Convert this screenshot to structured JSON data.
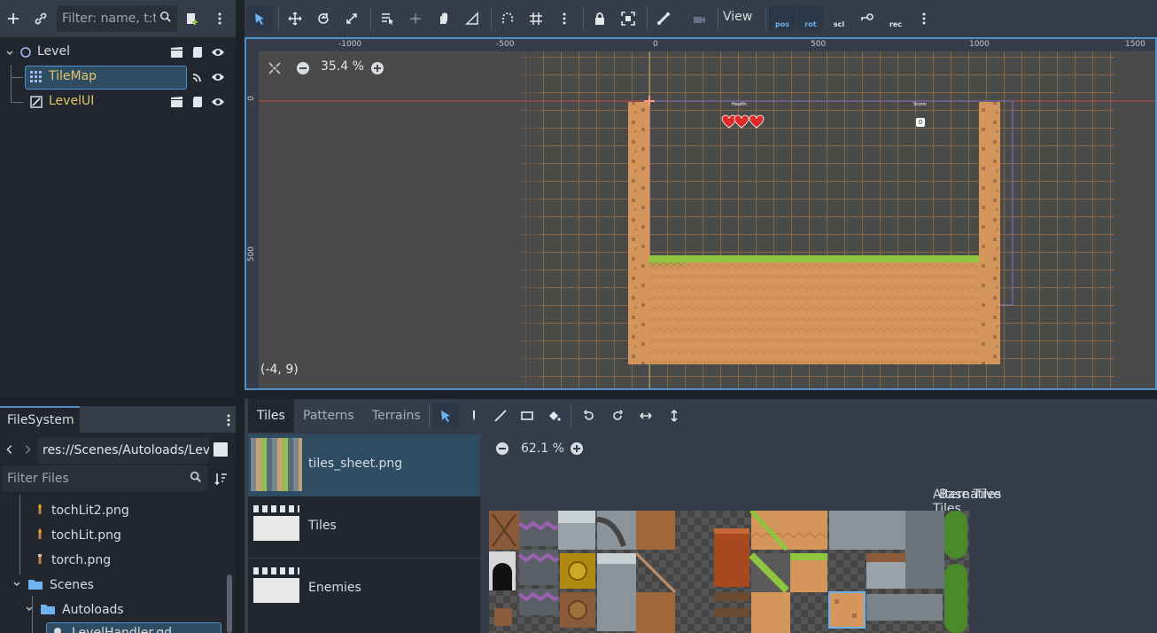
{
  "scene_dock": {
    "filter_placeholder": "Filter: name, t:t",
    "nodes": [
      {
        "label": "Level",
        "color": "#d8dce2"
      },
      {
        "label": "TileMap",
        "color": "#e6c56b"
      },
      {
        "label": "LevelUI",
        "color": "#e6c56b"
      }
    ]
  },
  "viewport": {
    "zoom": "35.4 %",
    "coord_readout": "(-4, 9)",
    "view_menu": "View",
    "toggles": [
      "pos",
      "rot",
      "scl",
      "rec"
    ],
    "ruler_h": [
      "-1000",
      "-500",
      "0",
      "500",
      "1000",
      "1500"
    ],
    "ruler_v": [
      "0",
      "500"
    ],
    "hud_labels": {
      "health": "Health:",
      "score": "Score:",
      "score_value": "0"
    }
  },
  "filesystem": {
    "tab_label": "FileSystem",
    "path": "res://Scenes/Autoloads/Lev",
    "filter_placeholder": "Filter Files",
    "items": [
      {
        "label": "tochLit2.png",
        "type": "file"
      },
      {
        "label": "tochLit.png",
        "type": "file"
      },
      {
        "label": "torch.png",
        "type": "file"
      },
      {
        "label": "Scenes",
        "type": "folder"
      },
      {
        "label": "Autoloads",
        "type": "folder"
      },
      {
        "label": "LevelHandler.gd",
        "type": "script"
      }
    ]
  },
  "tilemap": {
    "tabs": [
      "Tiles",
      "Patterns",
      "Terrains"
    ],
    "sources": [
      {
        "label": "tiles_sheet.png"
      },
      {
        "label": "Tiles"
      },
      {
        "label": "Enemies"
      }
    ],
    "atlas_zoom": "62.1 %",
    "base_tiles_label": "Base Tiles",
    "alternative_tiles_label": "Alternative Tiles"
  },
  "colors": {
    "accent": "#4f91c8",
    "selected_row": "#2f4d62",
    "node_yellow": "#e6c56b",
    "grid_orange": "#e08a3c",
    "dirt": "#d5965b",
    "grass": "#8ec63f"
  }
}
